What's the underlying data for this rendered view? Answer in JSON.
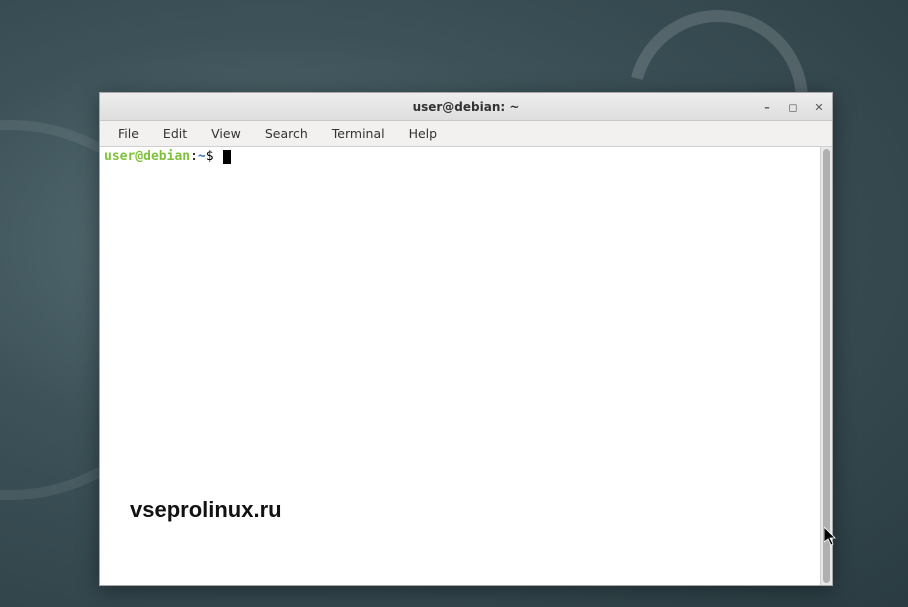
{
  "window": {
    "title": "user@debian: ~"
  },
  "menubar": {
    "items": [
      "File",
      "Edit",
      "View",
      "Search",
      "Terminal",
      "Help"
    ]
  },
  "prompt": {
    "userhost": "user@debian",
    "separator": ":",
    "path": "~",
    "symbol": "$"
  },
  "watermark": "vseprolinux.ru",
  "controls": {
    "minimize": "–",
    "maximize": "◻",
    "close": "✕"
  }
}
